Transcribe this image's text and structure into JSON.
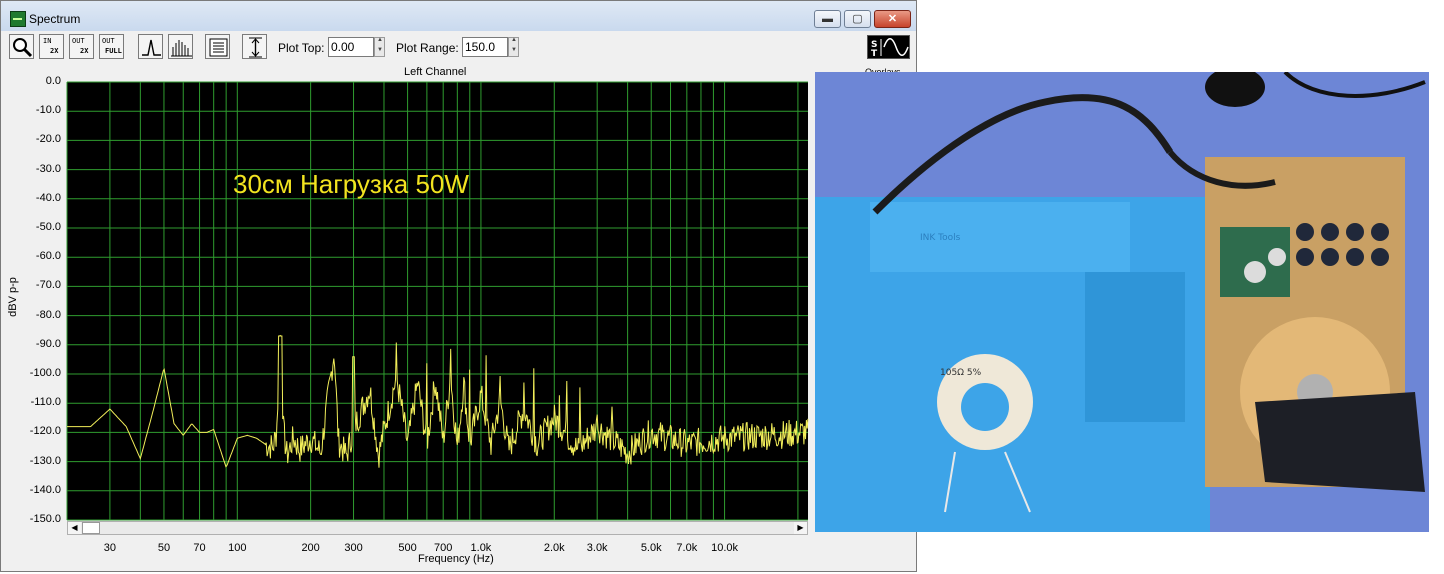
{
  "window": {
    "title": "Spectrum",
    "controls": {
      "minimize": "▬",
      "maximize": "▢",
      "close": "✕"
    }
  },
  "toolbar": {
    "buttons": [
      {
        "icon": "zoom-icon"
      },
      {
        "icon": "zoom-in-2x-icon",
        "text_top": "IN",
        "text_bottom": "2X"
      },
      {
        "icon": "zoom-out-2x-icon",
        "text_top": "OUT",
        "text_bottom": "2X"
      },
      {
        "icon": "zoom-out-full-icon",
        "text_top": "OUT",
        "text_bottom": "FULL"
      },
      {
        "icon": "line-spectrum-icon"
      },
      {
        "icon": "bar-spectrum-icon"
      },
      {
        "icon": "settings-list-icon"
      },
      {
        "icon": "autoscale-icon"
      }
    ],
    "plot_top_label": "Plot Top:",
    "plot_top_value": "0.00",
    "plot_range_label": "Plot Range:",
    "plot_range_value": "150.0",
    "waveform_toggle_icon": "sine-wave-icon"
  },
  "plot": {
    "channel_title": "Left Channel",
    "secondary_title": "Overlays",
    "annotation": "30см Нагрузка 50W",
    "colors": {
      "background": "#000000",
      "grid": "#2f9d2f",
      "trace": "#f2ee5a",
      "annotation": "#f2e320"
    }
  },
  "chart_data": {
    "type": "line",
    "title": "Left Channel",
    "xlabel": "Frequency (Hz)",
    "ylabel": "dBV p-p",
    "xscale": "log",
    "xlim": [
      20,
      22000
    ],
    "ylim": [
      -150,
      0
    ],
    "grid": true,
    "x_tick_labels": [
      "30",
      "50",
      "70",
      "100",
      "200",
      "300",
      "500",
      "700",
      "1.0k",
      "2.0k",
      "3.0k",
      "5.0k",
      "7.0k",
      "10.0k"
    ],
    "x_tick_values": [
      30,
      50,
      70,
      100,
      200,
      300,
      500,
      700,
      1000,
      2000,
      3000,
      5000,
      7000,
      10000
    ],
    "y_tick_labels": [
      "0.0",
      "-10.0",
      "-20.0",
      "-30.0",
      "-40.0",
      "-50.0",
      "-60.0",
      "-70.0",
      "-80.0",
      "-90.0",
      "-100.0",
      "-110.0",
      "-120.0",
      "-130.0",
      "-140.0",
      "-150.0"
    ],
    "series": [
      {
        "x": [
          20,
          25,
          30,
          35,
          40,
          45,
          50,
          55,
          60,
          65,
          70,
          75,
          80,
          90,
          100,
          110,
          120,
          130,
          140,
          145,
          150,
          155,
          160,
          170,
          180,
          200,
          220,
          250,
          260,
          280,
          300,
          350,
          380,
          400,
          450,
          500,
          550,
          600,
          650,
          700,
          750,
          800,
          850,
          900,
          1000,
          1100,
          1200,
          1300,
          1500,
          1700,
          2000,
          2500,
          3000,
          4000,
          5000,
          7000,
          10000,
          15000,
          22000
        ],
        "y": [
          -118,
          -118,
          -112,
          -118,
          -129,
          -113,
          -98,
          -117,
          -121,
          -117,
          -120,
          -120,
          -119,
          -132,
          -122,
          -121,
          -122,
          -124,
          -125,
          -120,
          -87,
          -120,
          -128,
          -122,
          -126,
          -122,
          -127,
          -92,
          -123,
          -128,
          -119,
          -105,
          -128,
          -119,
          -101,
          -124,
          -103,
          -124,
          -102,
          -123,
          -101,
          -125,
          -103,
          -124,
          -107,
          -124,
          -109,
          -126,
          -112,
          -124,
          -115,
          -126,
          -118,
          -127,
          -120,
          -124,
          -122,
          -121,
          -120
        ]
      }
    ]
  },
  "photo": {
    "labels": [
      "INK Tools",
      "105Ω 5%"
    ]
  }
}
